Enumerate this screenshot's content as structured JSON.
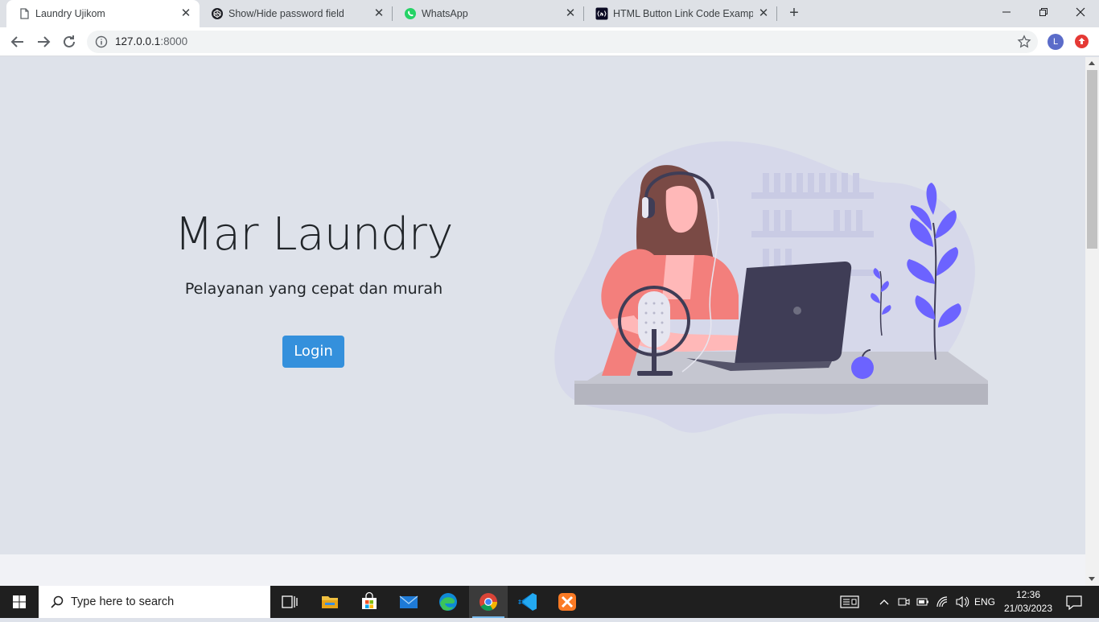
{
  "browser": {
    "tabs": [
      {
        "title": "Laundry Ujikom",
        "active": true,
        "favicon": "page-icon"
      },
      {
        "title": "Show/Hide password field",
        "active": false,
        "favicon": "codepen-icon"
      },
      {
        "title": "WhatsApp",
        "active": false,
        "favicon": "whatsapp-icon"
      },
      {
        "title": "HTML Button Link Code Example",
        "active": false,
        "favicon": "freecodecamp-icon"
      }
    ],
    "close_glyph": "✕",
    "new_tab_glyph": "+",
    "url_host": "127.0.0.1",
    "url_port": ":8000",
    "profile_initial": "L"
  },
  "page": {
    "title": "Mar Laundry",
    "subtitle": "Pelayanan yang cepat dan murah",
    "login_label": "Login"
  },
  "taskbar": {
    "search_placeholder": "Type here to search",
    "apps": [
      "task-view-icon",
      "file-explorer-icon",
      "microsoft-store-icon",
      "mail-icon",
      "edge-icon",
      "chrome-icon",
      "vscode-icon",
      "xampp-icon"
    ],
    "language": "ENG",
    "time": "12:36",
    "date": "21/03/2023"
  },
  "colors": {
    "accent": "#3490dc",
    "page_bg": "#dee2ea",
    "illustration_purple": "#6c63ff"
  }
}
